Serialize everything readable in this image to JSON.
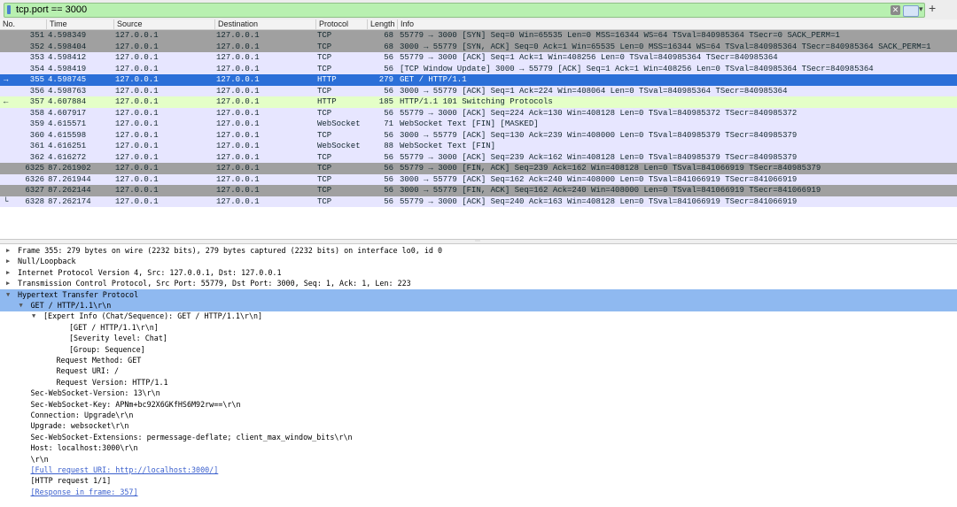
{
  "filter": {
    "value": "tcp.port == 3000",
    "clear_icon": "clear-icon",
    "apply_icon": "apply-arrow-icon",
    "add_icon": "plus-icon"
  },
  "columns": [
    "No.",
    "Time",
    "Source",
    "Destination",
    "Protocol",
    "Length",
    "Info"
  ],
  "packets": [
    {
      "no": "351",
      "time": "4.598349",
      "src": "127.0.0.1",
      "dst": "127.0.0.1",
      "proto": "TCP",
      "len": "68",
      "info": "55779 → 3000 [SYN] Seq=0 Win=65535 Len=0 MSS=16344 WS=64 TSval=840985364 TSecr=0 SACK_PERM=1",
      "bg": "#a0a0a0",
      "fg": "#12272e"
    },
    {
      "no": "352",
      "time": "4.598404",
      "src": "127.0.0.1",
      "dst": "127.0.0.1",
      "proto": "TCP",
      "len": "68",
      "info": "3000 → 55779 [SYN, ACK] Seq=0 Ack=1 Win=65535 Len=0 MSS=16344 WS=64 TSval=840985364 TSecr=840985364 SACK_PERM=1",
      "bg": "#a0a0a0",
      "fg": "#12272e"
    },
    {
      "no": "353",
      "time": "4.598412",
      "src": "127.0.0.1",
      "dst": "127.0.0.1",
      "proto": "TCP",
      "len": "56",
      "info": "55779 → 3000 [ACK] Seq=1 Ack=1 Win=408256 Len=0 TSval=840985364 TSecr=840985364",
      "bg": "#e7e6ff",
      "fg": "#12272e"
    },
    {
      "no": "354",
      "time": "4.598419",
      "src": "127.0.0.1",
      "dst": "127.0.0.1",
      "proto": "TCP",
      "len": "56",
      "info": "[TCP Window Update] 3000 → 55779 [ACK] Seq=1 Ack=1 Win=408256 Len=0 TSval=840985364 TSecr=840985364",
      "bg": "#e7e6ff",
      "fg": "#12272e"
    },
    {
      "no": "355",
      "time": "4.598745",
      "src": "127.0.0.1",
      "dst": "127.0.0.1",
      "proto": "HTTP",
      "len": "279",
      "info": "GET / HTTP/1.1",
      "bg": "#2b6fd8",
      "fg": "#ffffff",
      "mark": "→"
    },
    {
      "no": "356",
      "time": "4.598763",
      "src": "127.0.0.1",
      "dst": "127.0.0.1",
      "proto": "TCP",
      "len": "56",
      "info": "3000 → 55779 [ACK] Seq=1 Ack=224 Win=408064 Len=0 TSval=840985364 TSecr=840985364",
      "bg": "#e7e6ff",
      "fg": "#12272e"
    },
    {
      "no": "357",
      "time": "4.607884",
      "src": "127.0.0.1",
      "dst": "127.0.0.1",
      "proto": "HTTP",
      "len": "185",
      "info": "HTTP/1.1 101 Switching Protocols",
      "bg": "#e4ffc7",
      "fg": "#12272e",
      "mark": "←"
    },
    {
      "no": "358",
      "time": "4.607917",
      "src": "127.0.0.1",
      "dst": "127.0.0.1",
      "proto": "TCP",
      "len": "56",
      "info": "55779 → 3000 [ACK] Seq=224 Ack=130 Win=408128 Len=0 TSval=840985372 TSecr=840985372",
      "bg": "#e7e6ff",
      "fg": "#12272e"
    },
    {
      "no": "359",
      "time": "4.615571",
      "src": "127.0.0.1",
      "dst": "127.0.0.1",
      "proto": "WebSocket",
      "len": "71",
      "info": "WebSocket Text [FIN] [MASKED]",
      "bg": "#e7e6ff",
      "fg": "#12272e"
    },
    {
      "no": "360",
      "time": "4.615598",
      "src": "127.0.0.1",
      "dst": "127.0.0.1",
      "proto": "TCP",
      "len": "56",
      "info": "3000 → 55779 [ACK] Seq=130 Ack=239 Win=408000 Len=0 TSval=840985379 TSecr=840985379",
      "bg": "#e7e6ff",
      "fg": "#12272e"
    },
    {
      "no": "361",
      "time": "4.616251",
      "src": "127.0.0.1",
      "dst": "127.0.0.1",
      "proto": "WebSocket",
      "len": "88",
      "info": "WebSocket Text [FIN]",
      "bg": "#e7e6ff",
      "fg": "#12272e"
    },
    {
      "no": "362",
      "time": "4.616272",
      "src": "127.0.0.1",
      "dst": "127.0.0.1",
      "proto": "TCP",
      "len": "56",
      "info": "55779 → 3000 [ACK] Seq=239 Ack=162 Win=408128 Len=0 TSval=840985379 TSecr=840985379",
      "bg": "#e7e6ff",
      "fg": "#12272e"
    },
    {
      "no": "6325",
      "time": "87.261902",
      "src": "127.0.0.1",
      "dst": "127.0.0.1",
      "proto": "TCP",
      "len": "56",
      "info": "55779 → 3000 [FIN, ACK] Seq=239 Ack=162 Win=408128 Len=0 TSval=841066919 TSecr=840985379",
      "bg": "#a0a0a0",
      "fg": "#12272e"
    },
    {
      "no": "6326",
      "time": "87.261944",
      "src": "127.0.0.1",
      "dst": "127.0.0.1",
      "proto": "TCP",
      "len": "56",
      "info": "3000 → 55779 [ACK] Seq=162 Ack=240 Win=408000 Len=0 TSval=841066919 TSecr=841066919",
      "bg": "#e7e6ff",
      "fg": "#12272e"
    },
    {
      "no": "6327",
      "time": "87.262144",
      "src": "127.0.0.1",
      "dst": "127.0.0.1",
      "proto": "TCP",
      "len": "56",
      "info": "3000 → 55779 [FIN, ACK] Seq=162 Ack=240 Win=408000 Len=0 TSval=841066919 TSecr=841066919",
      "bg": "#a0a0a0",
      "fg": "#12272e"
    },
    {
      "no": "6328",
      "time": "87.262174",
      "src": "127.0.0.1",
      "dst": "127.0.0.1",
      "proto": "TCP",
      "len": "56",
      "info": "55779 → 3000 [ACK] Seq=240 Ack=163 Win=408128 Len=0 TSval=841066919 TSecr=841066919",
      "bg": "#e7e6ff",
      "fg": "#12272e",
      "mark": "└"
    }
  ],
  "details": [
    {
      "text": "Frame 355: 279 bytes on wire (2232 bits), 279 bytes captured (2232 bits) on interface lo0, id 0",
      "arrow": "▶",
      "indent": 0
    },
    {
      "text": "Null/Loopback",
      "arrow": "▶",
      "indent": 0
    },
    {
      "text": "Internet Protocol Version 4, Src: 127.0.0.1, Dst: 127.0.0.1",
      "arrow": "▶",
      "indent": 0
    },
    {
      "text": "Transmission Control Protocol, Src Port: 55779, Dst Port: 3000, Seq: 1, Ack: 1, Len: 223",
      "arrow": "▶",
      "indent": 0
    },
    {
      "text": "Hypertext Transfer Protocol",
      "arrow": "▼",
      "indent": 0,
      "selected": true
    },
    {
      "text": "GET / HTTP/1.1\\r\\n",
      "arrow": "▼",
      "indent": 1,
      "selected": true
    },
    {
      "text": "[Expert Info (Chat/Sequence): GET / HTTP/1.1\\r\\n]",
      "arrow": "▼",
      "indent": 2
    },
    {
      "text": "[GET / HTTP/1.1\\r\\n]",
      "arrow": "",
      "indent": 4
    },
    {
      "text": "[Severity level: Chat]",
      "arrow": "",
      "indent": 4
    },
    {
      "text": "[Group: Sequence]",
      "arrow": "",
      "indent": 4
    },
    {
      "text": "Request Method: GET",
      "arrow": "",
      "indent": 3
    },
    {
      "text": "Request URI: /",
      "arrow": "",
      "indent": 3
    },
    {
      "text": "Request Version: HTTP/1.1",
      "arrow": "",
      "indent": 3
    },
    {
      "text": "Sec-WebSocket-Version: 13\\r\\n",
      "arrow": "",
      "indent": 1
    },
    {
      "text": "Sec-WebSocket-Key: APNm+bc92X6GKfHS6M92rw==\\r\\n",
      "arrow": "",
      "indent": 1
    },
    {
      "text": "Connection: Upgrade\\r\\n",
      "arrow": "",
      "indent": 1
    },
    {
      "text": "Upgrade: websocket\\r\\n",
      "arrow": "",
      "indent": 1
    },
    {
      "text": "Sec-WebSocket-Extensions: permessage-deflate; client_max_window_bits\\r\\n",
      "arrow": "",
      "indent": 1
    },
    {
      "text": "Host: localhost:3000\\r\\n",
      "arrow": "",
      "indent": 1
    },
    {
      "text": "\\r\\n",
      "arrow": "",
      "indent": 1
    },
    {
      "text": "[Full request URI: http://localhost:3000/]",
      "arrow": "",
      "indent": 1,
      "link": true
    },
    {
      "text": "[HTTP request 1/1]",
      "arrow": "",
      "indent": 1
    },
    {
      "text": "[Response in frame: 357]",
      "arrow": "",
      "indent": 1,
      "link": true
    }
  ],
  "colors": {
    "selected_row": "#2b6fd8",
    "detail_selected": "#8fb9f0",
    "filter_bg": "#b8f0b0"
  }
}
